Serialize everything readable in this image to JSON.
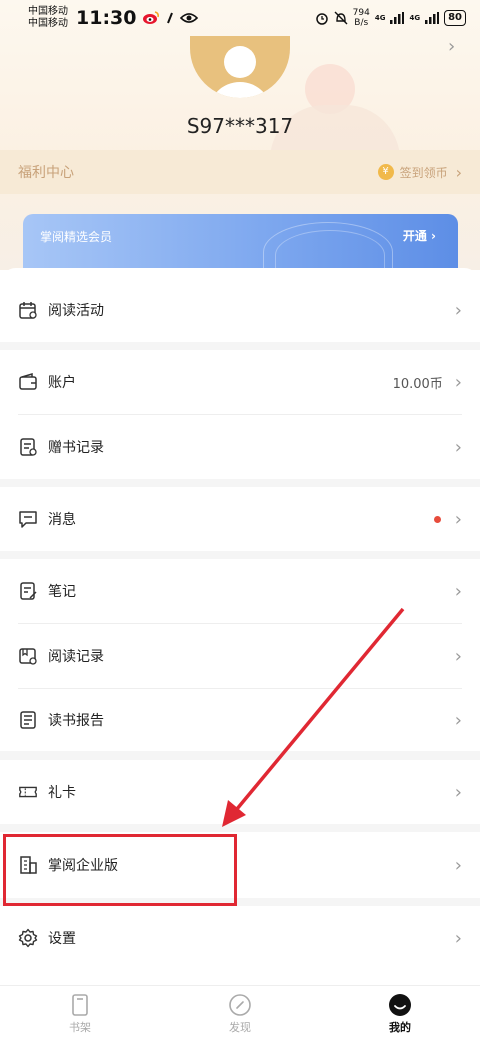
{
  "status_bar": {
    "carrier_1": "中国移动",
    "carrier_2": "中国移动",
    "time": "11:30",
    "net_speed_value": "794",
    "net_speed_unit": "B/s",
    "signal_1": "4G",
    "signal_2": "4G",
    "battery": "80"
  },
  "profile": {
    "username": "S97***317"
  },
  "welfare": {
    "label": "福利中心",
    "link": "签到领币",
    "coin_glyph": "¥"
  },
  "vip": {
    "label": "掌阅精选会员",
    "action": "开通"
  },
  "menu": {
    "reading_activity": "阅读活动",
    "account": "账户",
    "account_balance": "10.00币",
    "gift_record": "赠书记录",
    "messages": "消息",
    "notes": "笔记",
    "reading_history": "阅读记录",
    "reading_report": "读书报告",
    "gift_card": "礼卡",
    "enterprise": "掌阅企业版",
    "settings": "设置"
  },
  "tabs": [
    {
      "label": "书架"
    },
    {
      "label": "发现"
    },
    {
      "label": "我的"
    }
  ],
  "colors": {
    "accent_red": "#e02833",
    "vip_blue": "#6f9cea",
    "welfare_gold": "#c8a27a"
  }
}
